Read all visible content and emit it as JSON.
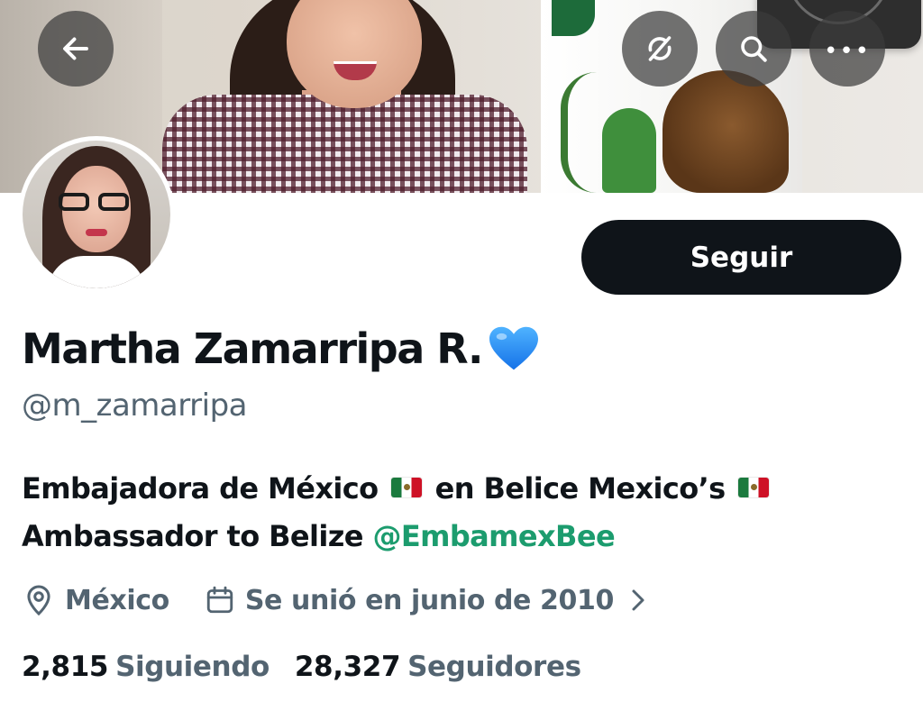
{
  "profile": {
    "display_name": "Martha Zamarripa R.",
    "name_emoji": "blue-heart-icon",
    "handle": "@m_zamarripa",
    "follow_label": "Seguir",
    "bio": {
      "line1_part1": "Embajadora de México",
      "line1_part2": "en Belice Mexico’s",
      "line2_part1": "Ambassador to Belize",
      "mention": "@EmbamexBee",
      "flag_emoji": "mexico-flag-icon"
    },
    "location": "México",
    "joined": "Se unió en junio de 2010",
    "following_count": "2,815",
    "following_label": "Siguiendo",
    "followers_count": "28,327",
    "followers_label": "Seguidores"
  },
  "header": {
    "icons": [
      "arrow-left-icon",
      "sync-off-icon",
      "search-icon",
      "more-icon"
    ]
  },
  "colors": {
    "text_primary": "#0f1419",
    "text_secondary": "#536471",
    "mention": "#1c9c6e",
    "button_bg": "#0f1419",
    "heart": "#1d8cf2"
  }
}
